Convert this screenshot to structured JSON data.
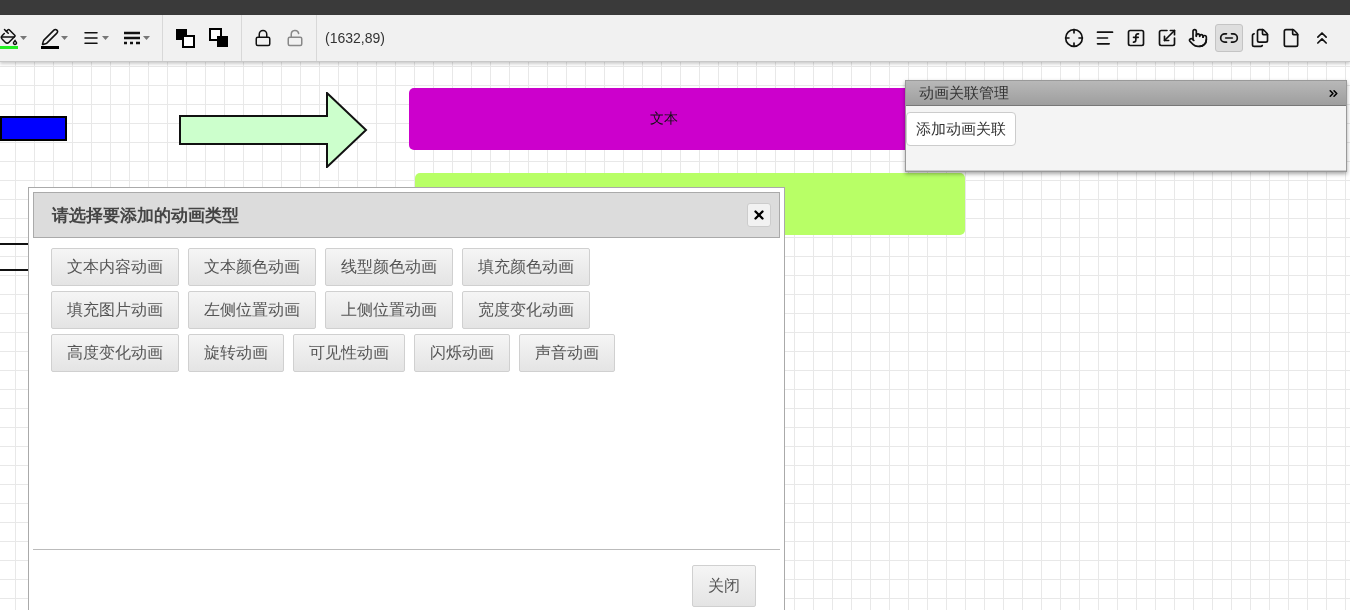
{
  "toolbar": {
    "coordinates": "(1632,89)",
    "right_tools": [
      {
        "selected": false
      },
      {
        "selected": false
      },
      {
        "selected": false
      },
      {
        "selected": false
      },
      {
        "selected": false
      },
      {
        "selected": true
      },
      {
        "selected": false
      },
      {
        "selected": false
      },
      {
        "selected": false
      }
    ]
  },
  "canvas": {
    "shapes": [
      {
        "kind": "bar",
        "color": "#0000ff"
      },
      {
        "kind": "arrow",
        "color": "#ccffcc"
      },
      {
        "kind": "box",
        "color": "#cc00cc",
        "text": "文本"
      },
      {
        "kind": "box",
        "color": "#b8ff66"
      },
      {
        "kind": "lines"
      }
    ]
  },
  "animation_dialog": {
    "title": "请选择要添加的动画类型",
    "options": [
      "文本内容动画",
      "文本颜色动画",
      "线型颜色动画",
      "填充颜色动画",
      "填充图片动画",
      "左侧位置动画",
      "上侧位置动画",
      "宽度变化动画",
      "高度变化动画",
      "旋转动画",
      "可见性动画",
      "闪烁动画",
      "声音动画"
    ],
    "close_button": "关闭"
  },
  "link_panel": {
    "title": "动画关联管理",
    "add_button": "添加动画关联"
  }
}
